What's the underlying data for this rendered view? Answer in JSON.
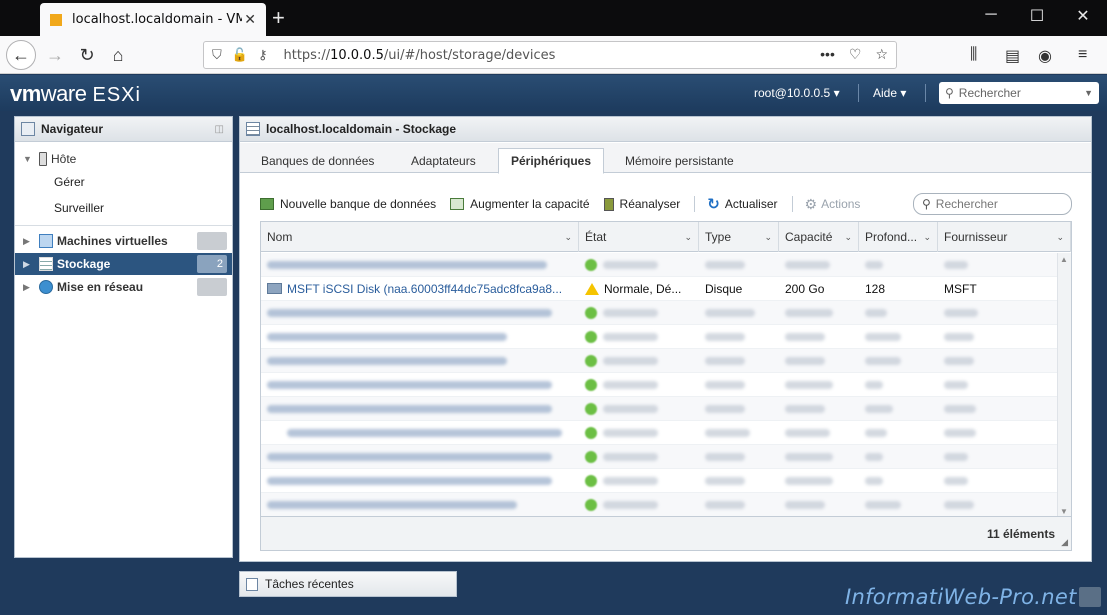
{
  "browser": {
    "tab_title": "localhost.localdomain - VMware ESXi",
    "url_host": "10.0.0.5",
    "url_prefix": "https://",
    "url_path": "/ui/#/host/storage/devices",
    "new_tab": "+",
    "minimize": "─",
    "maximize": "☐",
    "close": "✕"
  },
  "header": {
    "logo_vm": "vm",
    "logo_ware": "ware",
    "logo_product": "ESXi",
    "user": "root@10.0.0.5 ▾",
    "help": "Aide ▾",
    "search_placeholder": "Rechercher"
  },
  "navigator": {
    "title": "Navigateur",
    "host": "Hôte",
    "host_manage": "Gérer",
    "host_monitor": "Surveiller",
    "items": [
      {
        "label": "Machines virtuelles",
        "badge": ""
      },
      {
        "label": "Stockage",
        "badge": "2"
      },
      {
        "label": "Mise en réseau",
        "badge": ""
      }
    ]
  },
  "main": {
    "title": "localhost.localdomain - Stockage",
    "tabs": [
      "Banques de données",
      "Adaptateurs",
      "Périphériques",
      "Mémoire persistante"
    ],
    "active_tab": "Périphériques",
    "toolbar": {
      "new_datastore": "Nouvelle banque de données",
      "increase_capacity": "Augmenter la capacité",
      "rescan": "Réanalyser",
      "refresh": "Actualiser",
      "actions": "Actions",
      "search_placeholder": "Rechercher"
    },
    "columns": [
      "Nom",
      "État",
      "Type",
      "Capacité",
      "Profond...",
      "Fournisseur"
    ],
    "visible_row": {
      "name": "MSFT iSCSI Disk (naa.60003ff44dc75adc8fca9a8...",
      "state": "Normale, Dé...",
      "type": "Disque",
      "capacity": "200 Go",
      "depth": "128",
      "vendor": "MSFT"
    },
    "row_count_label": "11 éléments"
  },
  "recent_tasks": "Tâches récentes",
  "watermark": "InformatiWeb-Pro.net",
  "colors": {
    "header_bg": "#1d3b5e",
    "selected_nav": "#2c5580",
    "link": "#2a5d9c",
    "status_ok": "#6cbf44",
    "warning": "#f5c400"
  }
}
